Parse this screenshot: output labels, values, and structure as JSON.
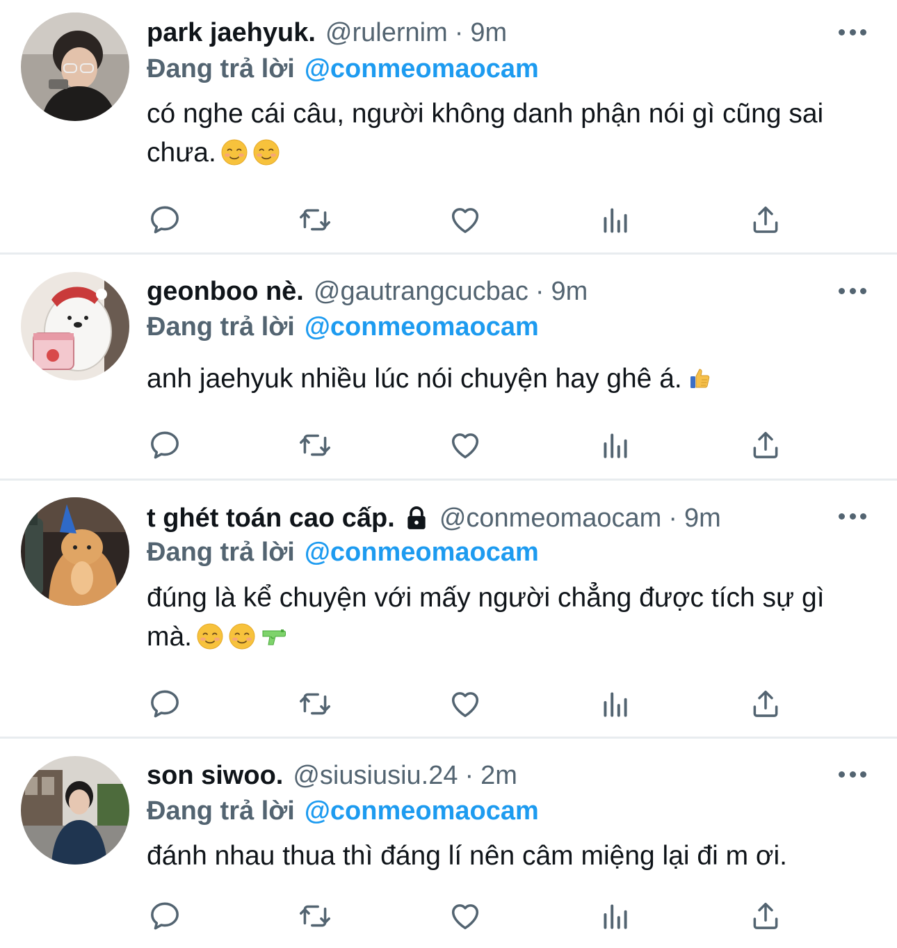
{
  "colors": {
    "accent": "#1d9bf0",
    "secondary_text": "#536471",
    "primary_text": "#0f1419",
    "divider": "#e8ecef"
  },
  "reply_label": "Đang trả lời",
  "separator": "·",
  "tweets": [
    {
      "name": "park jaehyuk.",
      "handle": "@rulernim",
      "time": "9m",
      "reply_to": "@conmeomaocam",
      "text": "có nghe cái câu, người không danh phận nói gì cũng sai chưa.",
      "emojis": [
        "smiling-face-emoji",
        "smiling-face-emoji"
      ],
      "locked": false
    },
    {
      "name": "geonboo nè.",
      "handle": "@gautrangcucbac",
      "time": "9m",
      "reply_to": "@conmeomaocam",
      "text": "anh jaehyuk nhiều lúc nói chuyện hay ghê á.",
      "emojis": [
        "thumbs-up-emoji"
      ],
      "locked": false
    },
    {
      "name": "t ghét toán cao cấp.",
      "handle": "@conmeomaocam",
      "time": "9m",
      "reply_to": "@conmeomaocam",
      "text": "đúng là kể chuyện với mấy người chẳng được tích sự gì mà.",
      "emojis": [
        "smiling-face-emoji",
        "smiling-face-emoji",
        "water-pistol-emoji"
      ],
      "locked": true,
      "lock_icon": "lock-icon"
    },
    {
      "name": "son siwoo.",
      "handle": "@siusiusiu.24",
      "time": "2m",
      "reply_to": "@conmeomaocam",
      "text": "đánh nhau thua thì đáng lí nên câm miệng lại đi m ơi.",
      "emojis": [],
      "locked": false
    }
  ],
  "action_icons": [
    "reply-icon",
    "retweet-icon",
    "like-icon",
    "views-icon",
    "share-icon"
  ],
  "more_icon": "more-options-icon"
}
